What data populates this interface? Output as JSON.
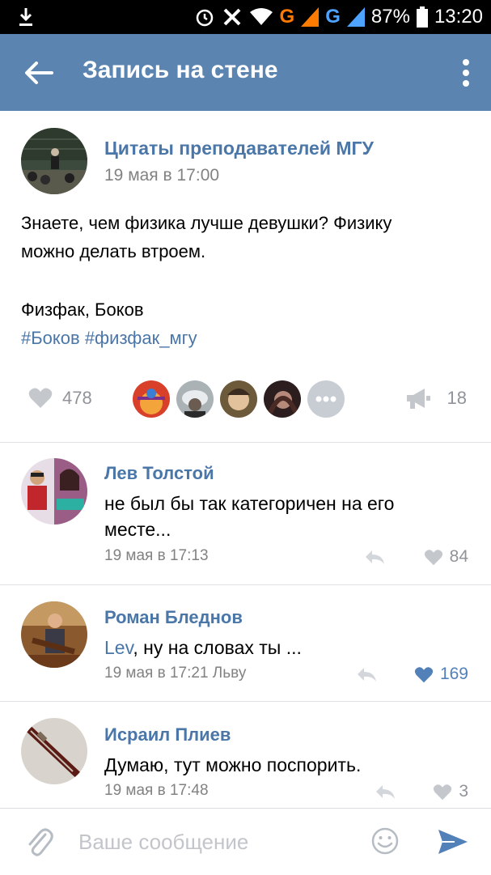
{
  "status_bar": {
    "network_g1": "G",
    "network_g2": "G",
    "battery": "87%",
    "time": "13:20"
  },
  "app_bar": {
    "title": "Запись на стене"
  },
  "post": {
    "author": "Цитаты преподавателей МГУ",
    "date": "19 мая в 17:00",
    "text_line1": "Знаете, чем физика лучше девушки? Физику",
    "text_line2": "можно делать втроем.",
    "signature": "Физфак, Боков",
    "tags": "#Боков #физфак_мгу",
    "likes": "478",
    "reposts": "18",
    "more_likers_label": "•••"
  },
  "comments": [
    {
      "name": "Лев Толстой",
      "text_line1": "не был бы так категоричен на его",
      "text_line2": "месте...",
      "meta": "19 мая в 17:13",
      "likes": "84"
    },
    {
      "name": "Роман Бледнов",
      "mention": "Lev",
      "text_rest": ", ну на словах ты ...",
      "meta": "19 мая в 17:21 Льву",
      "likes": "169"
    },
    {
      "name": "Исраил Плиев",
      "text_line1": "Думаю, тут можно поспорить.",
      "meta": "19 мая в 17:48",
      "likes": "3"
    }
  ],
  "composer": {
    "placeholder": "Ваше сообщение"
  },
  "colors": {
    "app_bar": "#5b84b1",
    "link": "#4a76a8",
    "liked": "#5181b8"
  }
}
